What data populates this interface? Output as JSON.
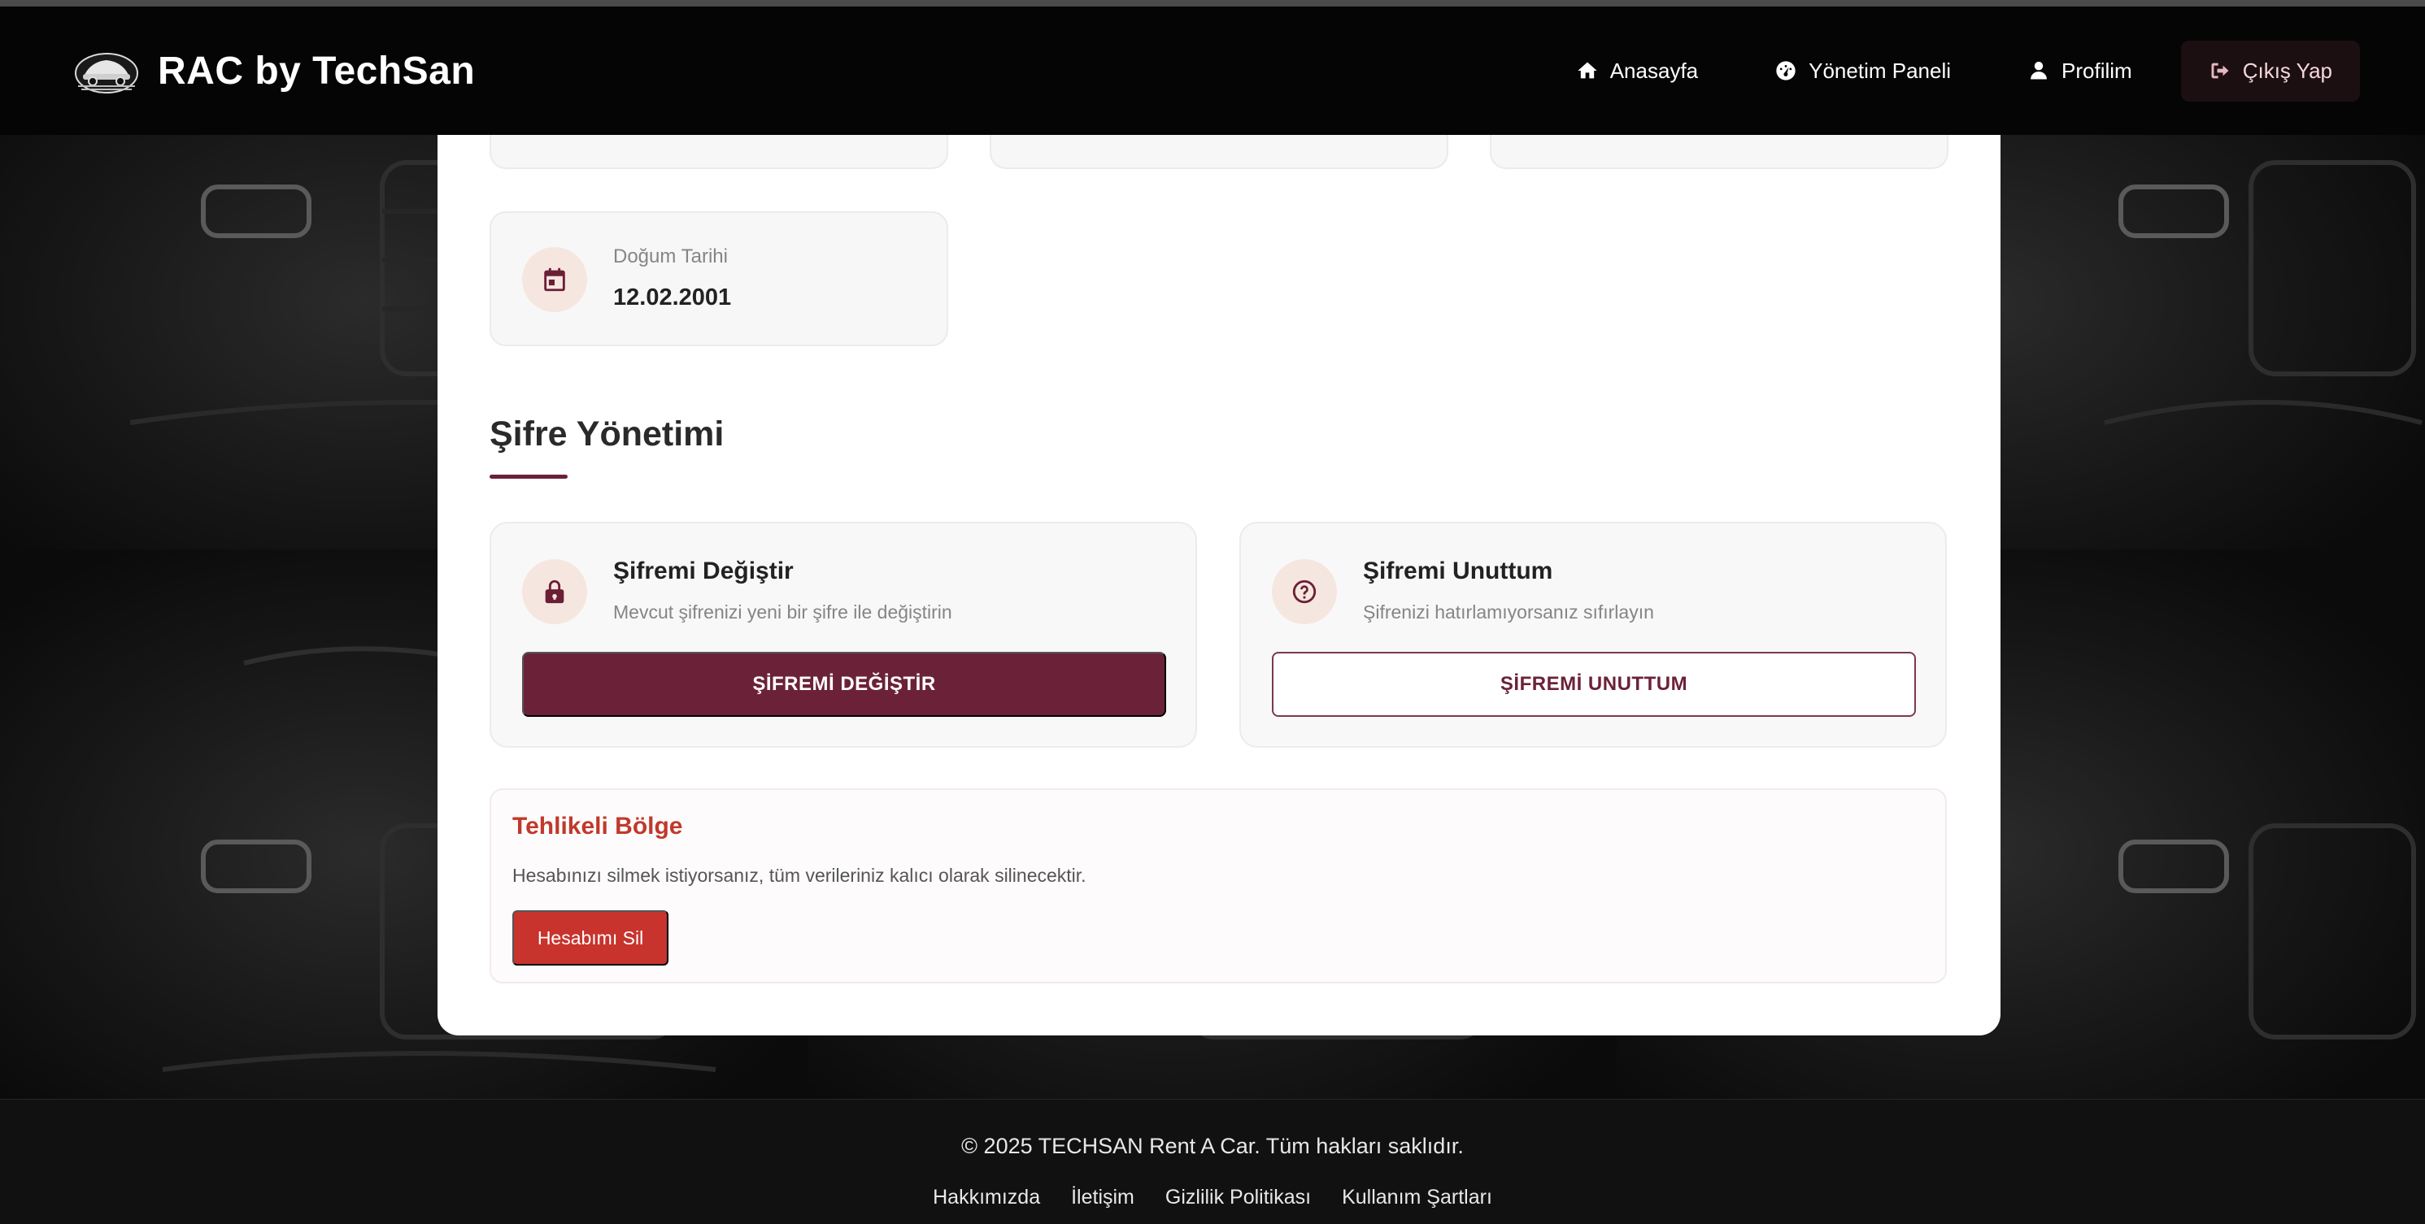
{
  "brand": {
    "name": "RAC by TechSan",
    "logo_icon": "car-logo-icon"
  },
  "nav": {
    "items": [
      {
        "label": "Anasayfa",
        "icon": "home-icon"
      },
      {
        "label": "Yönetim Paneli",
        "icon": "dashboard-icon"
      },
      {
        "label": "Profilim",
        "icon": "user-icon"
      },
      {
        "label": "Çıkış Yap",
        "icon": "logout-icon"
      }
    ]
  },
  "profile": {
    "birth_date": {
      "label": "Doğum Tarihi",
      "value": "12.02.2001",
      "icon": "calendar-icon"
    }
  },
  "password_section": {
    "title": "Şifre Yönetimi",
    "change": {
      "title": "Şifremi Değiştir",
      "description": "Mevcut şifrenizi yeni bir şifre ile değiştirin",
      "button": "ŞİFREMİ DEĞİŞTİR",
      "icon": "lock-icon"
    },
    "forgot": {
      "title": "Şifremi Unuttum",
      "description": "Şifrenizi hatırlamıyorsanız sıfırlayın",
      "button": "ŞİFREMİ UNUTTUM",
      "icon": "question-circle-icon"
    }
  },
  "danger_zone": {
    "title": "Tehlikeli Bölge",
    "description": "Hesabınızı silmek istiyorsanız, tüm verileriniz kalıcı olarak silinecektir.",
    "button": "Hesabımı Sil"
  },
  "footer": {
    "copyright": "© 2025 TECHSAN Rent A Car. Tüm hakları saklıdır.",
    "links": [
      "Hakkımızda",
      "İletişim",
      "Gizlilik Politikası",
      "Kullanım Şartları"
    ]
  },
  "colors": {
    "accent": "#6b2238",
    "danger": "#c8332d",
    "navbar": "#050505",
    "footer": "#111111"
  }
}
